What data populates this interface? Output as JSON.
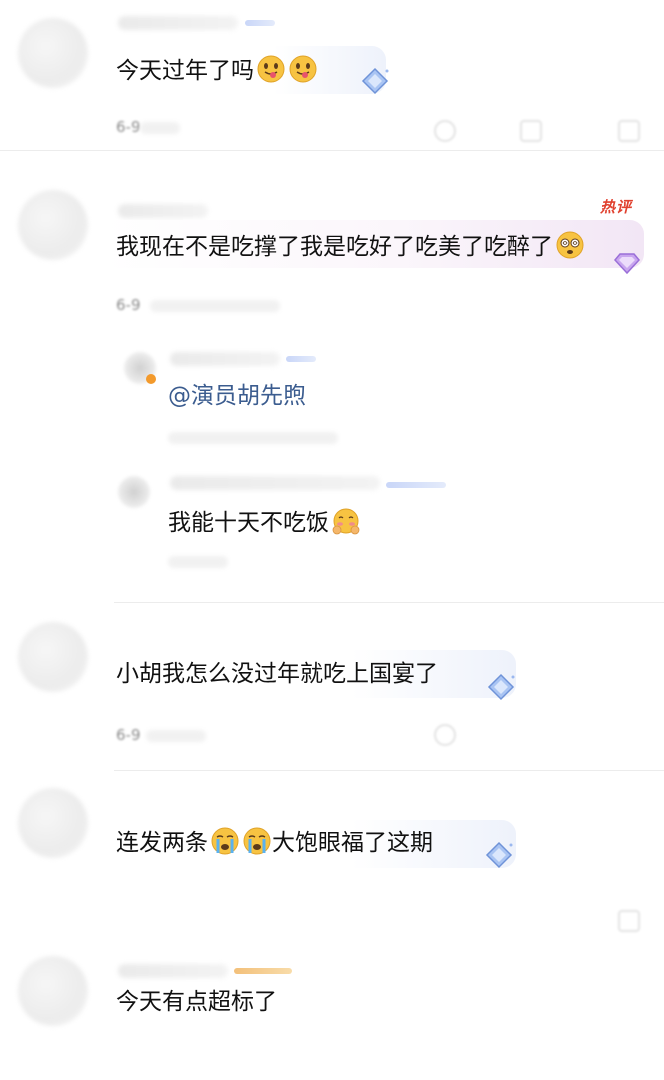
{
  "comments": [
    {
      "text": "今天过年了吗",
      "date": "6-9",
      "emojis": [
        "tongue-out-emoji",
        "tongue-out-emoji"
      ],
      "badge": "diamond-icon"
    },
    {
      "text": "我现在不是吃撑了我是吃好了吃美了吃醉了",
      "date": "6-9",
      "hot_label": "热评",
      "emojis": [
        "dizzy-face-emoji"
      ],
      "badge": "purple-diamond-icon",
      "replies": [
        {
          "text": "@演员胡先煦",
          "type": "mention"
        },
        {
          "text": "我能十天不吃饭",
          "emojis": [
            "blushing-hands-emoji"
          ]
        }
      ]
    },
    {
      "text": "小胡我怎么没过年就吃上国宴了",
      "date": "6-9",
      "badge": "diamond-icon"
    },
    {
      "text_before": "连发两条",
      "text_after": "大饱眼福了这期",
      "emojis": [
        "crying-face-emoji",
        "crying-face-emoji"
      ],
      "badge": "diamond-icon"
    },
    {
      "text": "今天有点超标了"
    }
  ],
  "colors": {
    "mention": "#3b5c8f",
    "hot": "#e0412f",
    "text": "#111111",
    "meta": "#8a8a8a"
  }
}
